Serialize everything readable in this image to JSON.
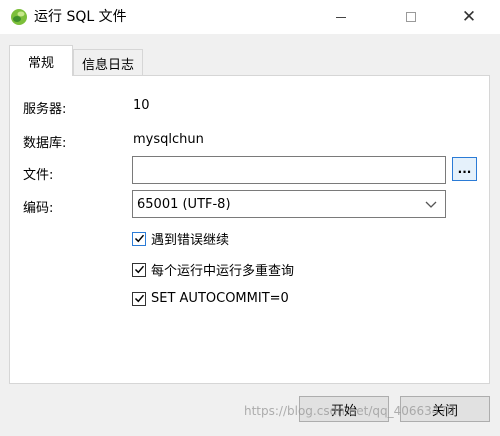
{
  "window": {
    "title": "运行 SQL 文件",
    "icon": "navicat-leaf-icon"
  },
  "tabs": [
    {
      "label": "常规",
      "active": true
    },
    {
      "label": "信息日志",
      "active": false
    }
  ],
  "fields": {
    "server_label": "服务器:",
    "server_value": "10",
    "database_label": "数据库:",
    "database_value": "mysqlchun",
    "file_label": "文件:",
    "file_value": "",
    "browse_label": "...",
    "encoding_label": "编码:",
    "encoding_value": "65001 (UTF-8)"
  },
  "options": [
    {
      "label": "遇到错误继续",
      "checked": true
    },
    {
      "label": "每个运行中运行多重查询",
      "checked": true
    },
    {
      "label": "SET AUTOCOMMIT=0",
      "checked": true
    }
  ],
  "buttons": {
    "start": "开始",
    "close": "关闭"
  },
  "watermark": "https://blog.csdn.net/qq_40663470",
  "colors": {
    "accent": "#2b7bd6",
    "dialog_bg": "#f0f0f0"
  }
}
